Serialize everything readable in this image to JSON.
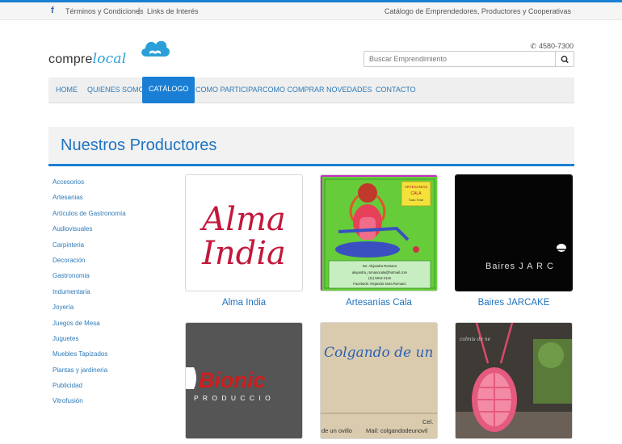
{
  "topbar": {
    "facebook": "f",
    "terms": "Términos y Condiciones",
    "separator": "|",
    "links": "Links de Interés",
    "tagline": "Catálogo de Emprendedores, Productores y Cooperativas"
  },
  "logo": {
    "part1": "compre",
    "part2": "local"
  },
  "contact": {
    "phone": "4580-7300"
  },
  "search": {
    "placeholder": "Buscar Emprendimiento"
  },
  "nav": [
    {
      "label": "HOME"
    },
    {
      "label": "QUIENES SOMOS"
    },
    {
      "label": "CATÁLOGO",
      "active": true
    },
    {
      "label": "COMO PARTICIPAR"
    },
    {
      "label": "COMO COMPRAR"
    },
    {
      "label": "NOVEDADES"
    },
    {
      "label": "CONTACTO"
    }
  ],
  "page": {
    "title": "Nuestros Productores"
  },
  "categories": [
    "Accesorios",
    "Artesanias",
    "Artículos de Gastronomía",
    "Audiovisuales",
    "Carpinteria",
    "Decoración",
    "Gastronomia",
    "Indumentaria",
    "Joyería",
    "Juegos de Mesa",
    "Juguetes",
    "Muebles Tapizados",
    "Plantas y jardineria",
    "Publicidad",
    "Vitrofusión"
  ],
  "producers": [
    {
      "name": "Alma India",
      "logo_line1": "Alma",
      "logo_line2": "India"
    },
    {
      "name": "Artesanías Cala",
      "card_title_1": "ARTESANIAS",
      "card_title_2": "CALA",
      "card_title_3": "Todo Telar",
      "card_line1": "De: Alejandra Romano",
      "card_line2": "alejandra_romanocala@hotmail.com",
      "card_line3": "(11) 5912-4115",
      "card_line4": "Facebook: Alejandra Nora Romano"
    },
    {
      "name": "Baires JARCAKE",
      "logo_text": "Baires J A R C"
    },
    {
      "name": "",
      "logo_text": "Bionic",
      "sub_text": "P R O D U C C I O"
    },
    {
      "name": "",
      "logo_text": "Colgando de un o",
      "footer_left": "de un ovillo",
      "footer_right": "Mail: colgandodeunovil",
      "footer_cel": "Cel."
    },
    {
      "name": "",
      "tag": "colmis de ne"
    }
  ],
  "colors": {
    "accent": "#1a7fd4",
    "link": "#2e7ab8",
    "heading": "#1e73c0"
  }
}
